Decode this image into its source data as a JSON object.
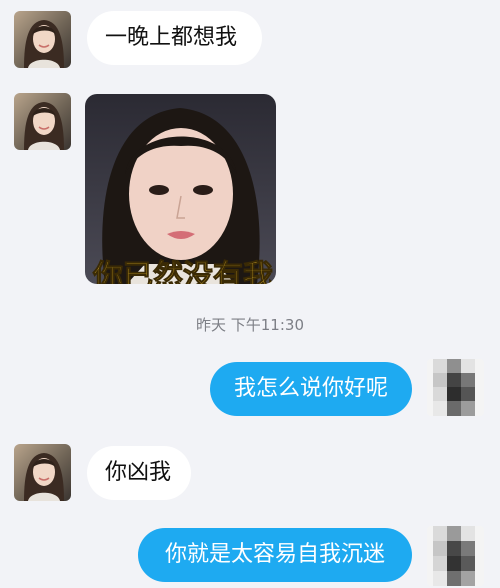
{
  "messages": [
    {
      "side": "received",
      "type": "text",
      "text": "一晚上都想我"
    },
    {
      "side": "received",
      "type": "sticker",
      "caption": "你已然没有我"
    },
    {
      "side": "system",
      "type": "timestamp",
      "text": "昨天 下午11:30"
    },
    {
      "side": "sent",
      "type": "text",
      "text": "我怎么说你好呢"
    },
    {
      "side": "received",
      "type": "text",
      "text": "你凶我"
    },
    {
      "side": "sent",
      "type": "text",
      "text": "你就是太容易自我沉迷"
    }
  ],
  "colors": {
    "background": "#f2f3f7",
    "sent_bubble": "#1eaaf1",
    "received_bubble": "#ffffff",
    "timestamp": "#7d7f86"
  },
  "icons": [
    "contact-avatar",
    "self-avatar-pixelated"
  ]
}
